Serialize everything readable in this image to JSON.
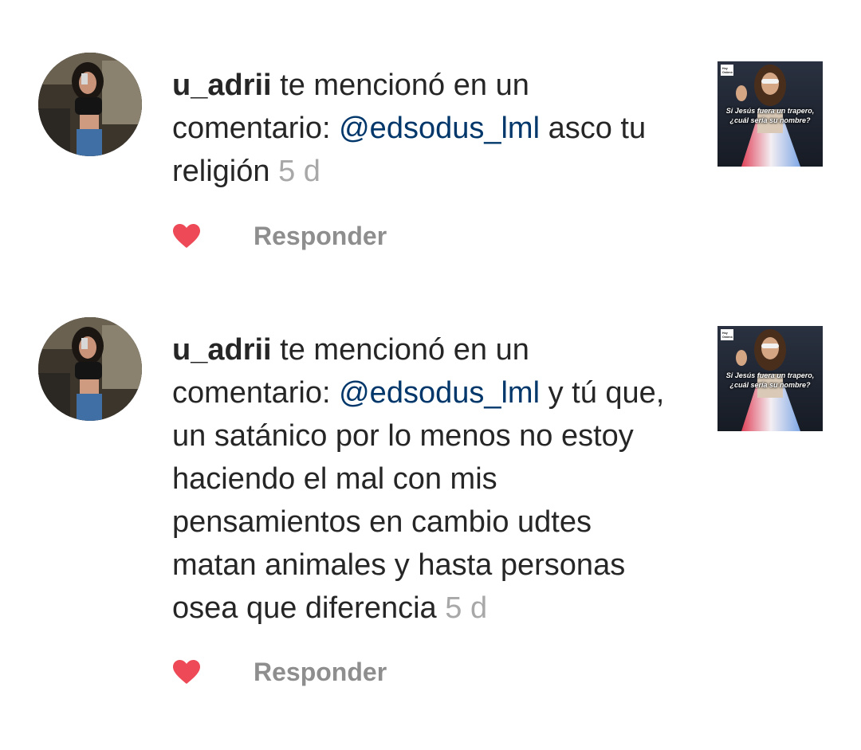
{
  "colors": {
    "mention": "#00376b",
    "heart": "#ed4956",
    "muted": "#8e8e8e",
    "time": "#a8a8a8",
    "text": "#262626"
  },
  "notifications": [
    {
      "username": "u_adrii",
      "action_text": "te mencionó en un comentario:",
      "mention": "@edsodus_lml",
      "comment": "asco tu religión",
      "time": "5 d",
      "liked": true,
      "reply_label": "Responder",
      "thumbnail": {
        "badge": "Hoy Ordenó",
        "caption_line1": "Si Jesús fuera un trapero,",
        "caption_line2": "¿cuál sería su nombre?"
      }
    },
    {
      "username": "u_adrii",
      "action_text": "te mencionó en un comentario:",
      "mention": "@edsodus_lml",
      "comment": "y tú que, un satánico por lo menos no estoy haciendo el mal con mis pensamientos en cambio udtes matan animales y hasta personas osea que diferencia",
      "time": "5 d",
      "liked": true,
      "reply_label": "Responder",
      "thumbnail": {
        "badge": "Hoy Ordenó",
        "caption_line1": "Si Jesús fuera un trapero,",
        "caption_line2": "¿cuál sería su nombre?"
      }
    }
  ]
}
